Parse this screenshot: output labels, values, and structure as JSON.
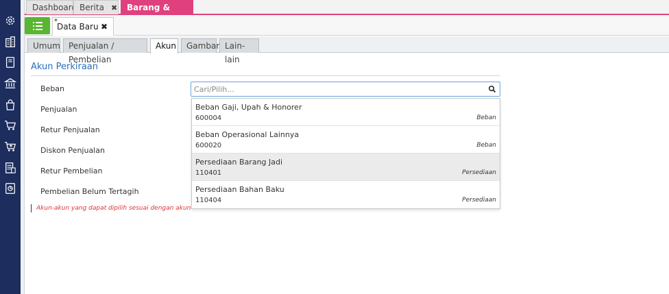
{
  "sidebar": {
    "icons": [
      "gear-icon",
      "building-icon",
      "book-icon",
      "bank-icon",
      "bag-icon",
      "cart-icon",
      "cart-plus-icon",
      "invoice-icon",
      "report-icon"
    ]
  },
  "top_tabs": [
    {
      "label": "Dashboard"
    },
    {
      "label": "Berita",
      "close": "✖"
    },
    {
      "label": "Barang & Jasa",
      "close": "✖"
    }
  ],
  "doc_tab": {
    "modified_mark": "*",
    "label": "Data Baru",
    "close": "✖"
  },
  "sub_tabs": [
    "Umum",
    "Penjualan / Pembelian",
    "Akun",
    "Gambar",
    "Lain-lain"
  ],
  "section": {
    "title": "Akun Perkiraan"
  },
  "fields": [
    "Beban",
    "Penjualan",
    "Retur Penjualan",
    "Diskon Penjualan",
    "Retur Pembelian",
    "Pembelian Belum Tertagih"
  ],
  "search": {
    "placeholder": "Cari/Pilih...",
    "value": ""
  },
  "options": [
    {
      "name": "Beban Gaji, Upah & Honorer",
      "code": "600004",
      "category": "Beban"
    },
    {
      "name": "Beban Operasional Lainnya",
      "code": "600020",
      "category": "Beban"
    },
    {
      "name": "Persediaan Barang Jadi",
      "code": "110401",
      "category": "Persediaan"
    },
    {
      "name": "Persediaan Bahan Baku",
      "code": "110404",
      "category": "Persediaan"
    }
  ],
  "note": "Akun-akun yang dapat dipilih sesuai dengan akun-akun yang ditentukan pada formulir Preferensi bagian akun default barang",
  "colors": {
    "sidebar": "#1c2d5e",
    "accent": "#e0407d",
    "menu_button": "#5ab530",
    "title": "#2a6ebb",
    "note": "#dd3333"
  }
}
